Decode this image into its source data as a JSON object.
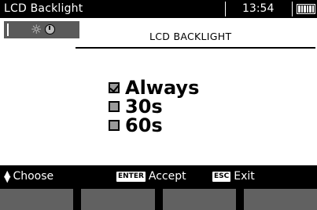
{
  "status_bar": {
    "title": "LCD Backlight",
    "time": "13:54",
    "battery_level": "full"
  },
  "header": {
    "screen_title": "LCD BACKLIGHT",
    "tab_icons": [
      "sun-icon",
      "clock-icon"
    ]
  },
  "options": [
    {
      "label": "Always",
      "checked": true
    },
    {
      "label": "30s",
      "checked": false
    },
    {
      "label": "60s",
      "checked": false
    }
  ],
  "hints": {
    "choose": "Choose",
    "enter_key": "ENTER",
    "accept": "Accept",
    "esc_key": "ESC",
    "exit": "Exit"
  },
  "function_keys": 4
}
